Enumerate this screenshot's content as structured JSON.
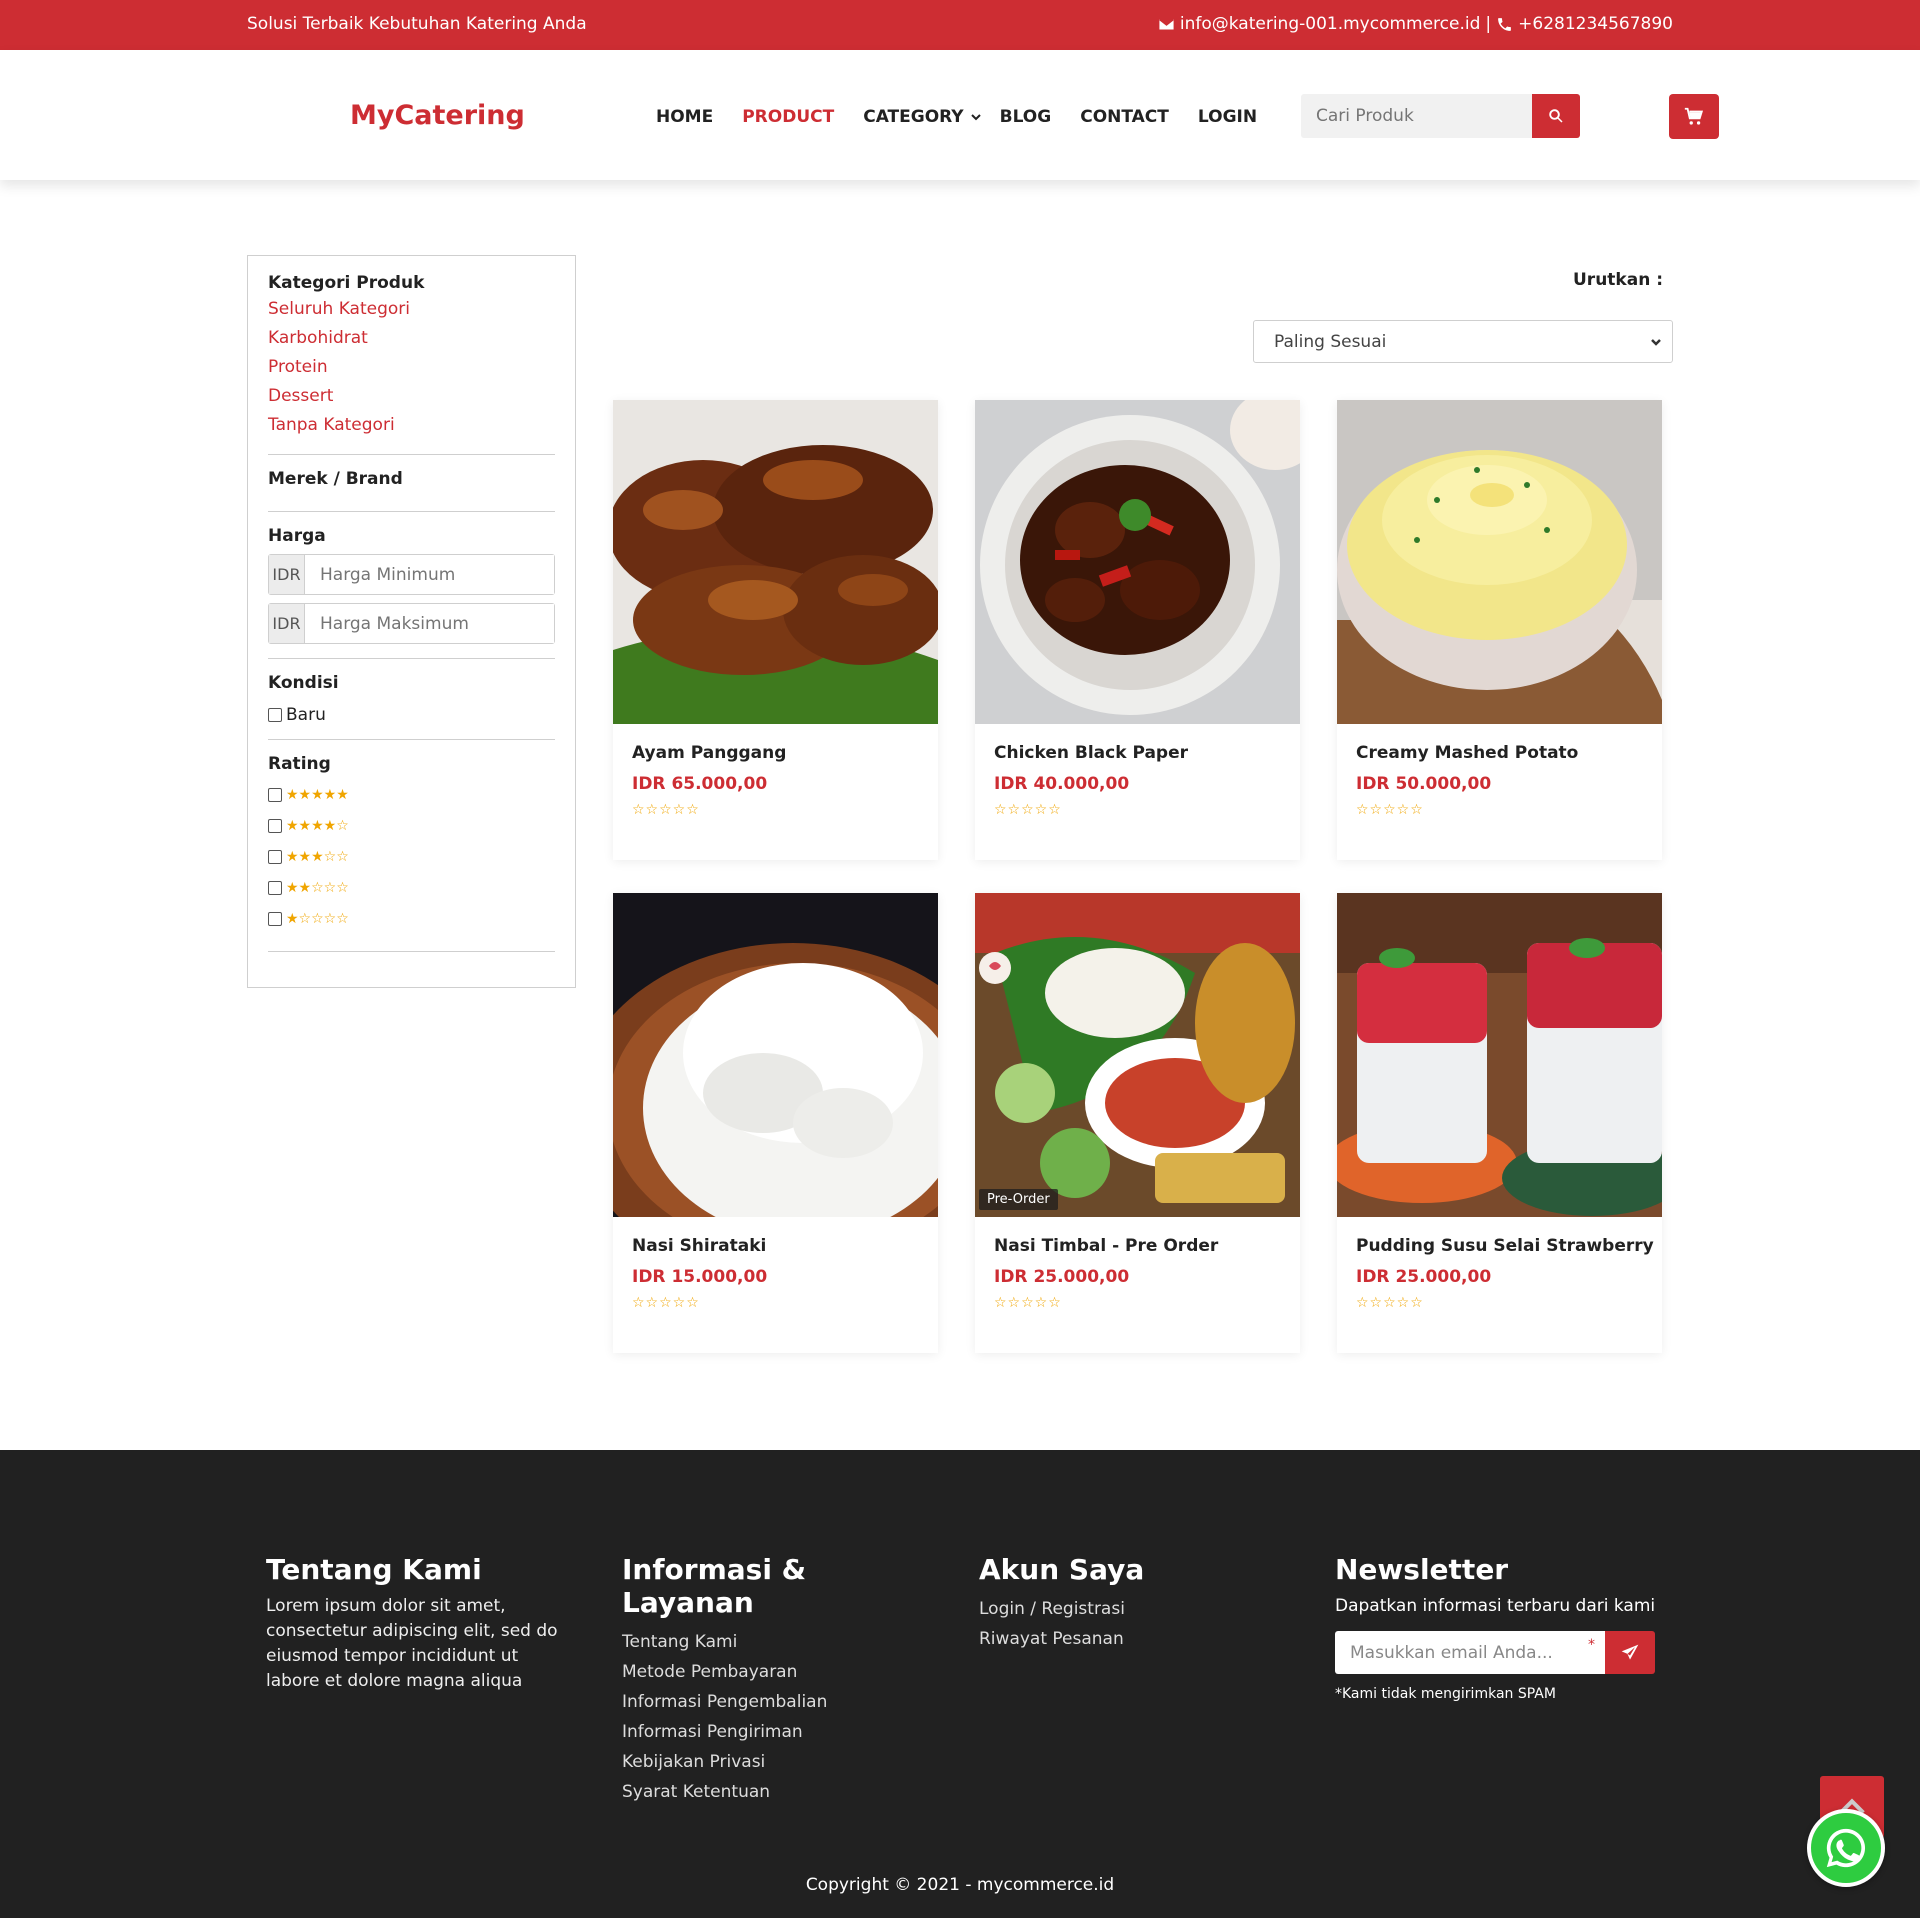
{
  "topbar": {
    "tagline": "Solusi Terbaik Kebutuhan Katering Anda",
    "email": "info@katering-001.mycommerce.id",
    "separator": "|",
    "phone": "+6281234567890"
  },
  "header": {
    "logo": "MyCatering",
    "nav": [
      {
        "label": "HOME"
      },
      {
        "label": "PRODUCT"
      },
      {
        "label": "CATEGORY"
      },
      {
        "label": "BLOG"
      },
      {
        "label": "CONTACT"
      },
      {
        "label": "LOGIN"
      }
    ],
    "search_placeholder": "Cari Produk"
  },
  "sidebar": {
    "category_title": "Kategori Produk",
    "categories": [
      "Seluruh Kategori",
      "Karbohidrat",
      "Protein",
      "Dessert",
      "Tanpa Kategori"
    ],
    "brand_title": "Merek / Brand",
    "price_title": "Harga",
    "currency": "IDR",
    "price_min_placeholder": "Harga Minimum",
    "price_max_placeholder": "Harga Maksimum",
    "condition_title": "Kondisi",
    "condition_option": "Baru",
    "rating_title": "Rating",
    "rating_options": [
      "★★★★★",
      "★★★★☆",
      "★★★☆☆",
      "★★☆☆☆",
      "★☆☆☆☆"
    ]
  },
  "sort": {
    "label": "Urutkan :",
    "selected": "Paling Sesuai"
  },
  "products": [
    {
      "name": "Ayam Panggang",
      "price": "IDR 65.000,00",
      "stars": "☆☆☆☆☆",
      "badge": ""
    },
    {
      "name": "Chicken Black Paper",
      "price": "IDR 40.000,00",
      "stars": "☆☆☆☆☆",
      "badge": ""
    },
    {
      "name": "Creamy Mashed Potato",
      "price": "IDR 50.000,00",
      "stars": "☆☆☆☆☆",
      "badge": ""
    },
    {
      "name": "Nasi Shirataki",
      "price": "IDR 15.000,00",
      "stars": "☆☆☆☆☆",
      "badge": ""
    },
    {
      "name": "Nasi Timbal - Pre Order",
      "price": "IDR 25.000,00",
      "stars": "☆☆☆☆☆",
      "badge": "Pre-Order"
    },
    {
      "name": "Pudding Susu Selai Strawberry",
      "price": "IDR 25.000,00",
      "stars": "☆☆☆☆☆",
      "badge": ""
    }
  ],
  "footer": {
    "about_title": "Tentang Kami",
    "about_text": "Lorem ipsum dolor sit amet, consectetur adipiscing elit, sed do eiusmod tempor incididunt ut labore et dolore magna aliqua",
    "info_title": "Informasi & Layanan",
    "info_links": [
      "Tentang Kami",
      "Metode Pembayaran",
      "Informasi Pengembalian",
      "Informasi Pengiriman",
      "Kebijakan Privasi",
      "Syarat Ketentuan"
    ],
    "account_title": "Akun Saya",
    "account_links": [
      "Login / Registrasi",
      "Riwayat Pesanan"
    ],
    "newsletter_title": "Newsletter",
    "newsletter_text": "Dapatkan informasi terbaru dari kami",
    "newsletter_placeholder": "Masukkan email Anda...",
    "required_mark": "*",
    "no_spam": "*Kami tidak mengirimkan SPAM",
    "copyright": "Copyright © 2021 - mycommerce.id"
  },
  "colors": {
    "brand": "#cd2d33",
    "footer_bg": "#212121",
    "star": "#f0a500",
    "whatsapp": "#2ecc40"
  },
  "icons": [
    "envelope-icon",
    "phone-icon",
    "search-icon",
    "cart-icon",
    "chevron-down-icon",
    "send-icon",
    "arrow-up-icon",
    "whatsapp-icon"
  ]
}
